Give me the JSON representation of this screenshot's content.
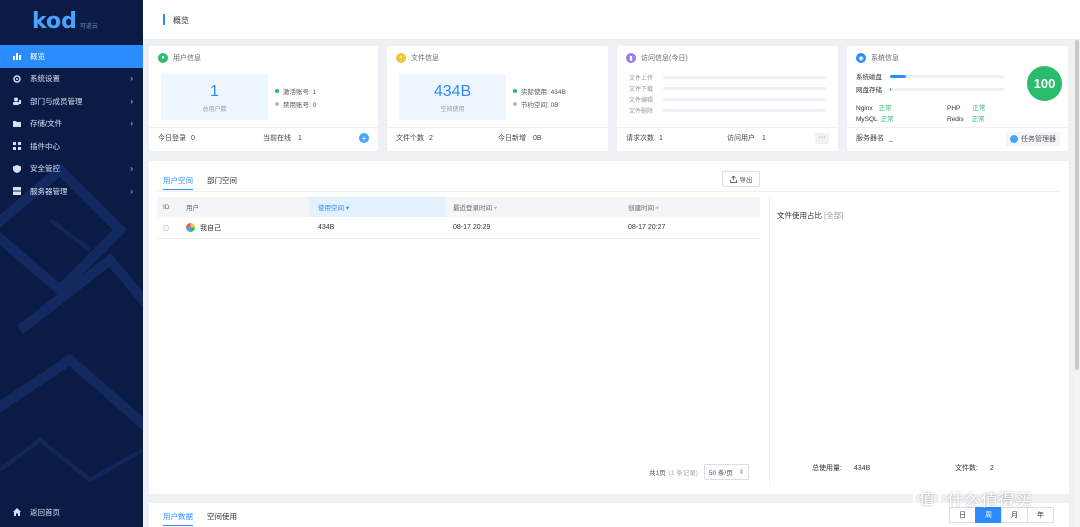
{
  "brand": {
    "logo": "kod",
    "sub": "可道云"
  },
  "sidebar": {
    "items": [
      {
        "label": "概览",
        "icon": "bar-chart-icon",
        "active": true,
        "chevron": false
      },
      {
        "label": "系统设置",
        "icon": "gear-icon",
        "active": false,
        "chevron": true
      },
      {
        "label": "部门与成员管理",
        "icon": "users-icon",
        "active": false,
        "chevron": true
      },
      {
        "label": "存储/文件",
        "icon": "folder-icon",
        "active": false,
        "chevron": true
      },
      {
        "label": "插件中心",
        "icon": "grid-icon",
        "active": false,
        "chevron": false
      },
      {
        "label": "安全管控",
        "icon": "shield-icon",
        "active": false,
        "chevron": true
      },
      {
        "label": "服务器管理",
        "icon": "server-icon",
        "active": false,
        "chevron": true
      }
    ],
    "back_home": "返回首页"
  },
  "header": {
    "title": "概览"
  },
  "cards": {
    "user": {
      "title": "用户信息",
      "big_value": "1",
      "big_label": "总用户数",
      "stats": [
        "激活账号: 1",
        "禁用账号: 0"
      ],
      "foot_left_label": "今日登录",
      "foot_left_value": "0",
      "foot_mid_label": "当前在线",
      "foot_mid_value": "1"
    },
    "file": {
      "title": "文件信息",
      "big_value": "434B",
      "big_label": "空间使用",
      "stats": [
        "实际使用: 434B",
        "节约空间: 0B"
      ],
      "foot_left_label": "文件个数",
      "foot_left_value": "2",
      "foot_mid_label": "今日新增",
      "foot_mid_value": "0B"
    },
    "visit": {
      "title": "访问信息(今日)",
      "rows": [
        "文件上传",
        "文件下载",
        "文件编辑",
        "文件删除"
      ],
      "foot_left_label": "请求次数",
      "foot_left_value": "1",
      "foot_mid_label": "访问用户",
      "foot_mid_value": "1",
      "more": "···"
    },
    "system": {
      "title": "系统信息",
      "disk_label": "系统磁盘",
      "disk_usage": 0.14,
      "netdisk_label": "网盘存储",
      "netdisk_usage": 0.01,
      "score": "100",
      "services": [
        {
          "name": "Nginx",
          "status": "正常"
        },
        {
          "name": "PHP",
          "status": "正常"
        },
        {
          "name": "MySQL",
          "status": "正常"
        },
        {
          "name": "Redis",
          "status": "正常"
        }
      ],
      "server_label": "服务器名",
      "server_value": "_",
      "task_button": "任务管理器"
    }
  },
  "main": {
    "tabs": [
      "用户空间",
      "部门空间"
    ],
    "export": "导出",
    "columns": [
      "ID",
      "用户",
      "使用空间",
      "最近登录时间",
      "创建时间"
    ],
    "rows": [
      {
        "id": "",
        "user": "我自己",
        "usage": "434B",
        "last_login": "08-17 20:29",
        "created": "08-17 20:27"
      }
    ],
    "usage_title": "文件使用占比",
    "usage_all": "[全部]",
    "pager": {
      "pages": "共1页",
      "records": "(1 条记录)",
      "per_page": "50 条/页"
    },
    "total_label": "总使用量:",
    "total_value": "434B",
    "count_label": "文件数:",
    "count_value": "2"
  },
  "bottom": {
    "tabs": [
      "用户数据",
      "空间使用"
    ],
    "period": [
      "日",
      "周",
      "月",
      "年"
    ],
    "active_period": "周"
  },
  "watermark": {
    "text": "什么值得买",
    "icon": "值"
  }
}
